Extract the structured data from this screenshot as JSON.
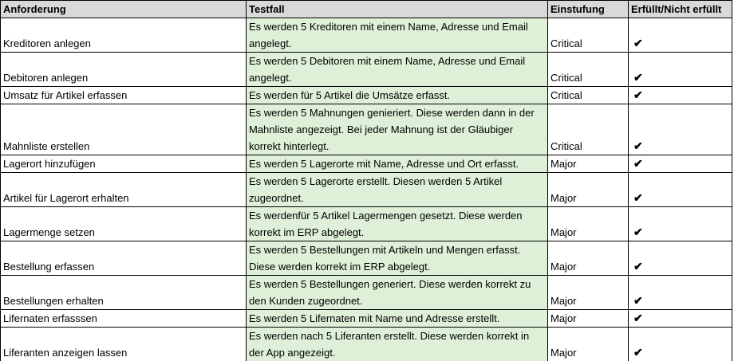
{
  "headers": [
    "Anforderung",
    "Testfall",
    "Einstufung",
    "Erfüllt/Nicht erfüllt"
  ],
  "rows": [
    {
      "anforderung": "Kreditoren anlegen",
      "testfall": "Es werden 5 Kreditoren mit einem Name, Adresse und Email angelegt.",
      "einstufung": "Critical",
      "erfuellt": "✔"
    },
    {
      "anforderung": "Debitoren anlegen",
      "testfall": "Es werden 5 Debitoren mit einem Name, Adresse und Email angelegt.",
      "einstufung": "Critical",
      "erfuellt": "✔"
    },
    {
      "anforderung": "Umsatz für Artikel erfassen",
      "testfall": "Es werden für 5 Artikel die Umsätze erfasst.",
      "einstufung": "Critical",
      "erfuellt": "✔"
    },
    {
      "anforderung": "Mahnliste erstellen",
      "testfall": "Es werden 5 Mahnungen genieriert. Diese werden dann in der Mahnliste angezeigt. Bei jeder Mahnung ist der Gläubiger korrekt hinterlegt.",
      "einstufung": "Critical",
      "erfuellt": "✔"
    },
    {
      "anforderung": "Lagerort hinzufügen",
      "testfall": "Es werden 5 Lagerorte mit Name, Adresse und Ort erfasst.",
      "einstufung": "Major",
      "erfuellt": "✔"
    },
    {
      "anforderung": "Artikel für Lagerort erhalten",
      "testfall": "Es werden 5 Lagerorte erstellt. Diesen werden 5 Artikel zugeordnet.",
      "einstufung": "Major",
      "erfuellt": "✔"
    },
    {
      "anforderung": "Lagermenge setzen",
      "testfall": "Es werdenfür 5 Artikel Lagermengen gesetzt. Diese werden korrekt im ERP abgelegt.",
      "einstufung": "Major",
      "erfuellt": "✔"
    },
    {
      "anforderung": "Bestellung erfassen",
      "testfall": "Es werden 5 Bestellungen mit Artikeln und Mengen erfasst. Diese werden korrekt im ERP abgelegt.",
      "einstufung": "Major",
      "erfuellt": "✔"
    },
    {
      "anforderung": "Bestellungen erhalten",
      "testfall": "Es werden 5 Bestellungen generiert. Diese werden korrekt zu den Kunden zugeordnet.",
      "einstufung": "Major",
      "erfuellt": "✔"
    },
    {
      "anforderung": "Lifernaten erfasssen",
      "testfall": "Es werden 5 Lifernaten mit Name und Adresse erstellt.",
      "einstufung": "Major",
      "erfuellt": "✔"
    },
    {
      "anforderung": "Liferanten anzeigen lassen",
      "testfall": "Es werden nach 5 Liferanten erstellt. Diese werden korrekt in der App angezeigt.",
      "einstufung": "Major",
      "erfuellt": "✔"
    }
  ]
}
